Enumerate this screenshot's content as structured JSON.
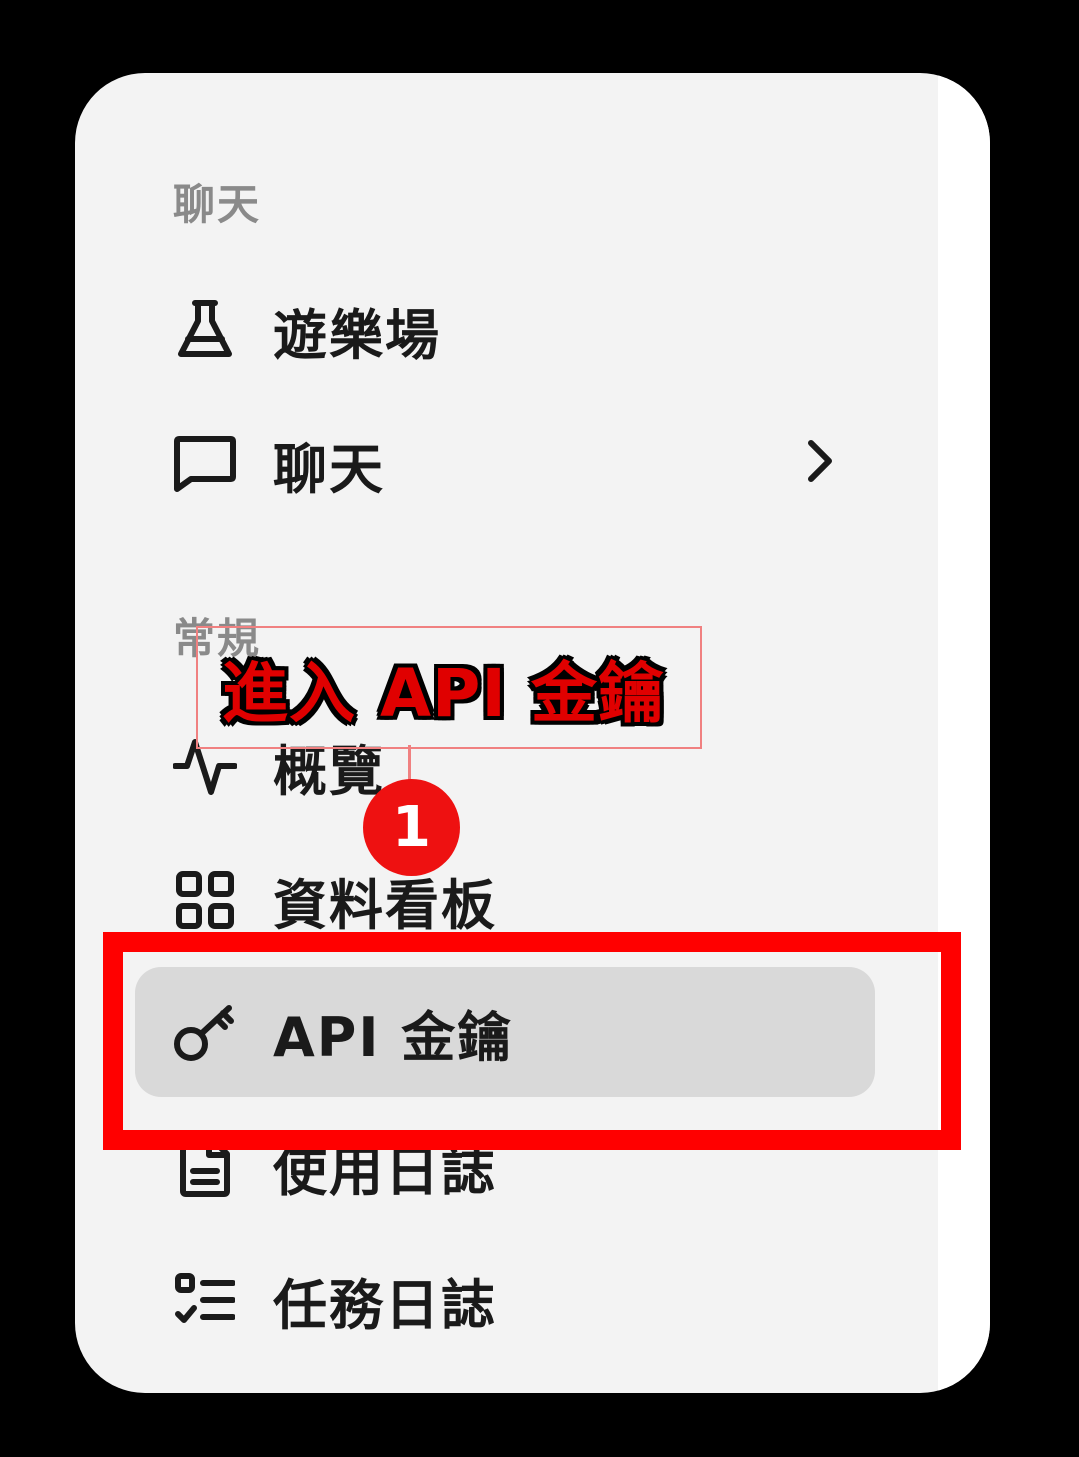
{
  "sidebar": {
    "sections": [
      {
        "label": "聊天",
        "items": [
          {
            "label": "遊樂場",
            "icon": "flask-icon"
          },
          {
            "label": "聊天",
            "icon": "chat-bubble-icon",
            "has_submenu": true
          }
        ]
      },
      {
        "label": "常規",
        "items": [
          {
            "label": "概覽",
            "icon": "activity-icon"
          },
          {
            "label": "資料看板",
            "icon": "dashboard-icon"
          },
          {
            "label": "API 金鑰",
            "icon": "key-icon",
            "active": true
          },
          {
            "label": "使用日誌",
            "icon": "document-icon"
          },
          {
            "label": "任務日誌",
            "icon": "task-list-icon"
          }
        ]
      }
    ]
  },
  "annotation": {
    "callout_text": "進入 API 金鑰",
    "step_number": "1",
    "highlight_color": "#ff0000"
  }
}
